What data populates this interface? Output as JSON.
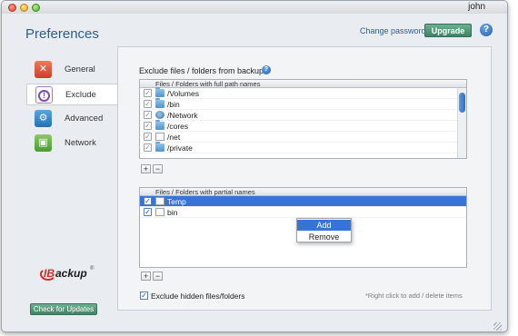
{
  "window": {
    "user": "john"
  },
  "header": {
    "title": "Preferences",
    "change_password": "Change password",
    "upgrade": "Upgrade",
    "help_icon": "help-icon"
  },
  "sidebar": {
    "items": [
      {
        "label": "General",
        "icon": "wrench-icon"
      },
      {
        "label": "Exclude",
        "icon": "exclude-icon",
        "selected": true
      },
      {
        "label": "Advanced",
        "icon": "gear-icon"
      },
      {
        "label": "Network",
        "icon": "network-icon"
      }
    ],
    "logo_text_ib": "IB",
    "logo_text_backup": "ackup",
    "logo_reg": "®",
    "check_updates": "Check for Updates"
  },
  "main": {
    "section_title": "Exclude files / folders from backup",
    "full_path": {
      "header": "Files / Folders with full path names",
      "rows": [
        {
          "label": "/Volumes",
          "icon": "folder-icon",
          "checked": true
        },
        {
          "label": "/bin",
          "icon": "folder-icon",
          "checked": true
        },
        {
          "label": "/Network",
          "icon": "network-folder-icon",
          "checked": true
        },
        {
          "label": "/cores",
          "icon": "folder-icon",
          "checked": true
        },
        {
          "label": "/net",
          "icon": "file-icon",
          "checked": true
        },
        {
          "label": "/private",
          "icon": "folder-icon",
          "checked": true
        }
      ]
    },
    "partial": {
      "header": "Files / Folders with partial names",
      "rows": [
        {
          "label": "Temp",
          "icon": "file-icon",
          "checked": true,
          "selected": true
        },
        {
          "label": "bin",
          "icon": "file-icon",
          "checked": true
        }
      ]
    },
    "add_label": "+",
    "remove_label": "−",
    "check_mark": "✓",
    "context_menu": {
      "add": "Add",
      "remove": "Remove"
    },
    "exclude_hidden": "Exclude hidden files/folders",
    "hint": "*Right click to add / delete items"
  },
  "colors": {
    "accent": "#2c5d8f",
    "upgrade_green": "#3f8465",
    "selection_blue": "#3874d8"
  }
}
